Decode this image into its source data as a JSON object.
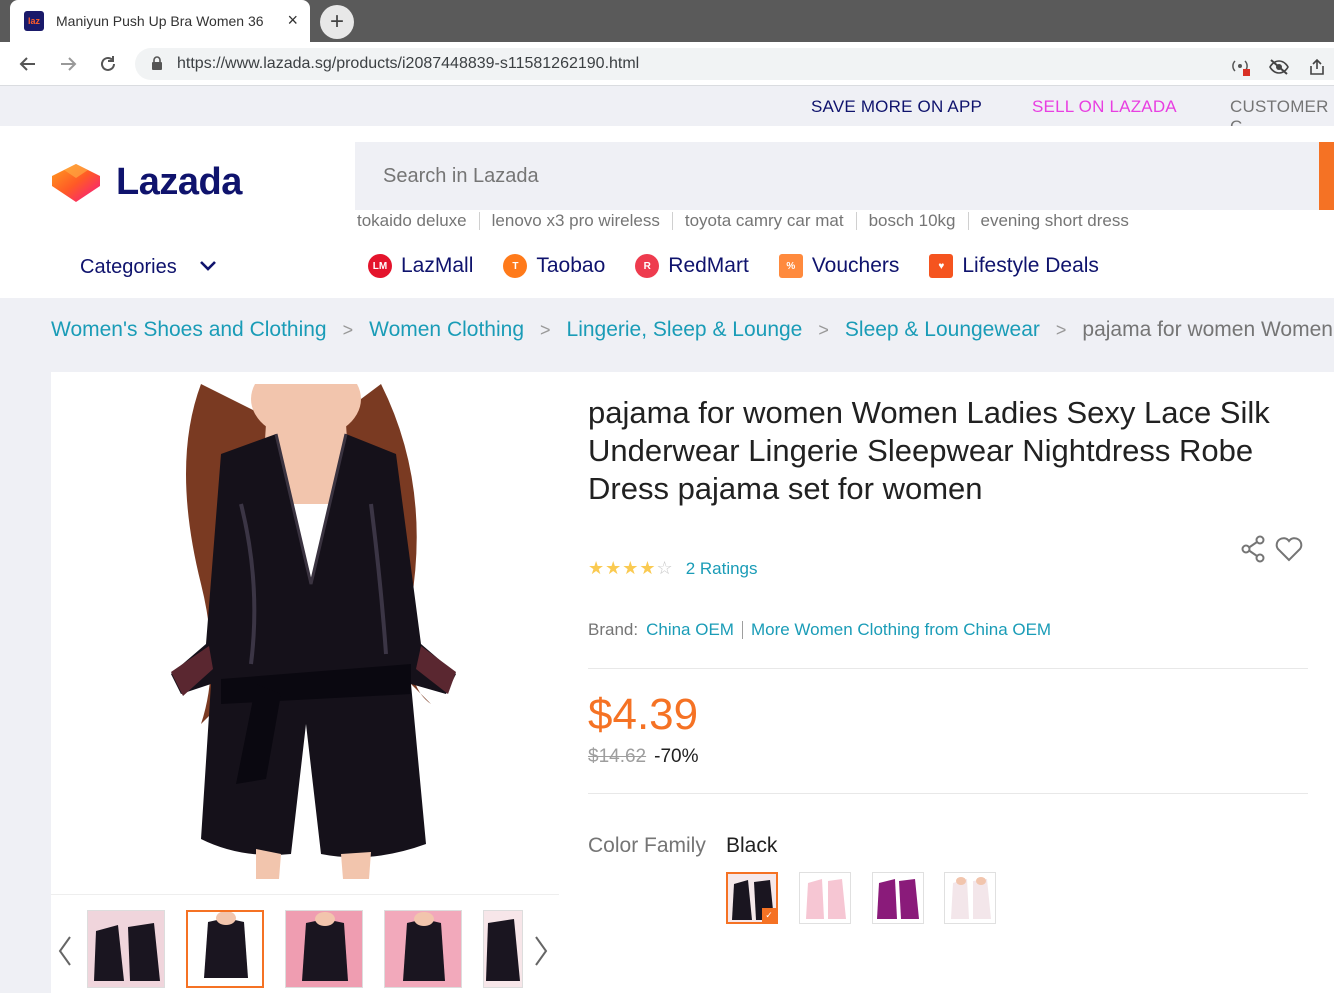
{
  "browser": {
    "tab_title": "Maniyun Push Up Bra Women 36",
    "tab_close": "×",
    "new_tab": "+",
    "favicon_text": "laz",
    "url": "https://www.lazada.sg/products/i2087448839-s11581262190.html"
  },
  "top_links": {
    "save_more": "SAVE MORE ON APP",
    "sell": "SELL ON LAZADA",
    "customer": "CUSTOMER C"
  },
  "header": {
    "logo_text": "Lazada",
    "search_placeholder": "Search in Lazada",
    "suggestions": [
      "tokaido deluxe",
      "lenovo x3 pro wireless",
      "toyota camry car mat",
      "bosch 10kg",
      "evening short dress"
    ],
    "categories_label": "Categories",
    "channels": [
      {
        "label": "LazMall",
        "icon": "lazmall-icon",
        "color": "#e4142c"
      },
      {
        "label": "Taobao",
        "icon": "taobao-icon",
        "color": "#ff7a1a"
      },
      {
        "label": "RedMart",
        "icon": "redmart-icon",
        "color": "#ee3b4e"
      },
      {
        "label": "Vouchers",
        "icon": "voucher-icon",
        "color": "#ff8a3d"
      },
      {
        "label": "Lifestyle Deals",
        "icon": "lifestyle-deals-icon",
        "color": "#f5541f"
      }
    ]
  },
  "breadcrumb": {
    "items": [
      "Women's Shoes and Clothing",
      "Women Clothing",
      "Lingerie, Sleep & Lounge",
      "Sleep & Loungewear"
    ],
    "current": "pajama for women Women La"
  },
  "product": {
    "title": "pajama for women Women Ladies Sexy Lace Silk Underwear Lingerie Sleepwear Nightdress Robe Dress pajama set for women",
    "rating_stars": 4,
    "ratings_text": "2 Ratings",
    "brand_label": "Brand:",
    "brand": "China OEM",
    "more_from": "More Women Clothing from China OEM",
    "price": "$4.39",
    "original_price": "$14.62",
    "discount": "-70%",
    "color_family_label": "Color Family",
    "color_value": "Black",
    "swatches": [
      "black",
      "pink",
      "purple",
      "white"
    ],
    "accent": "#f57224",
    "link_color": "#1a9cb7"
  }
}
